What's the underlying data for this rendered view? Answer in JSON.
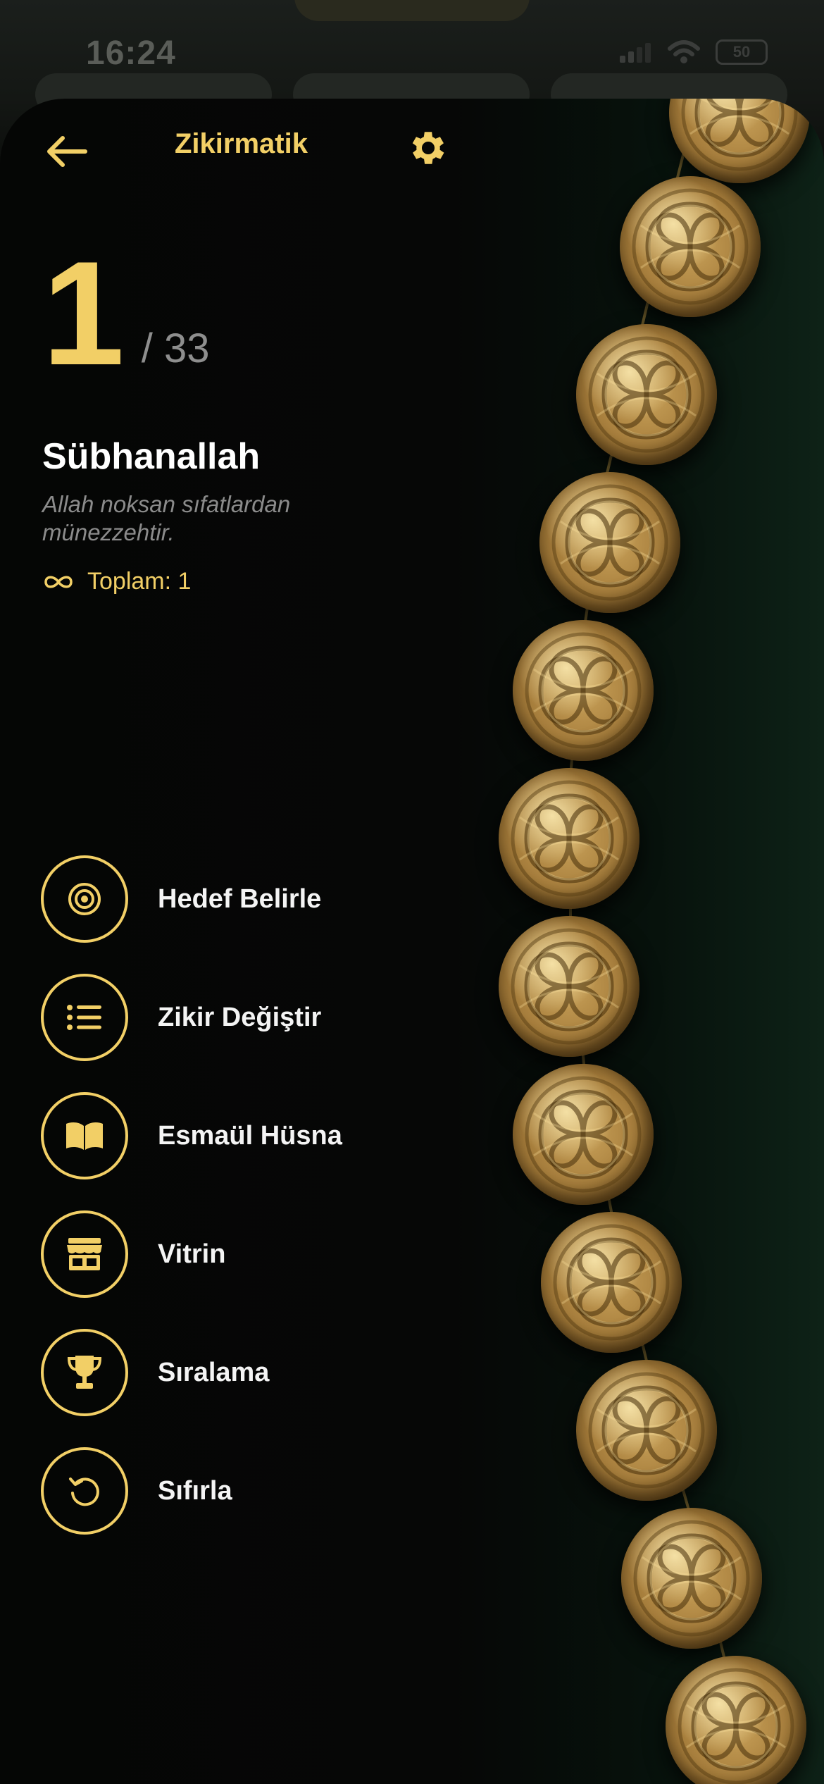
{
  "status_bar": {
    "time": "16:24",
    "battery": "50"
  },
  "header": {
    "title": "Zikirmatik"
  },
  "counter": {
    "current": "1",
    "target": "/ 33"
  },
  "zikr": {
    "name": "Sübhanallah",
    "meaning": "Allah noksan sıfatlardan münezzehtir.",
    "total_label": "Toplam: 1"
  },
  "menu": [
    {
      "label": "Hedef Belirle",
      "icon": "target-icon"
    },
    {
      "label": "Zikir Değiştir",
      "icon": "list-icon"
    },
    {
      "label": "Esmaül Hüsna",
      "icon": "book-icon"
    },
    {
      "label": "Vitrin",
      "icon": "store-icon"
    },
    {
      "label": "Sıralama",
      "icon": "trophy-icon"
    },
    {
      "label": "Sıfırla",
      "icon": "reset-icon"
    }
  ],
  "colors": {
    "accent": "#f2cf66",
    "background": "#050605",
    "muted": "#8e8e8e"
  }
}
